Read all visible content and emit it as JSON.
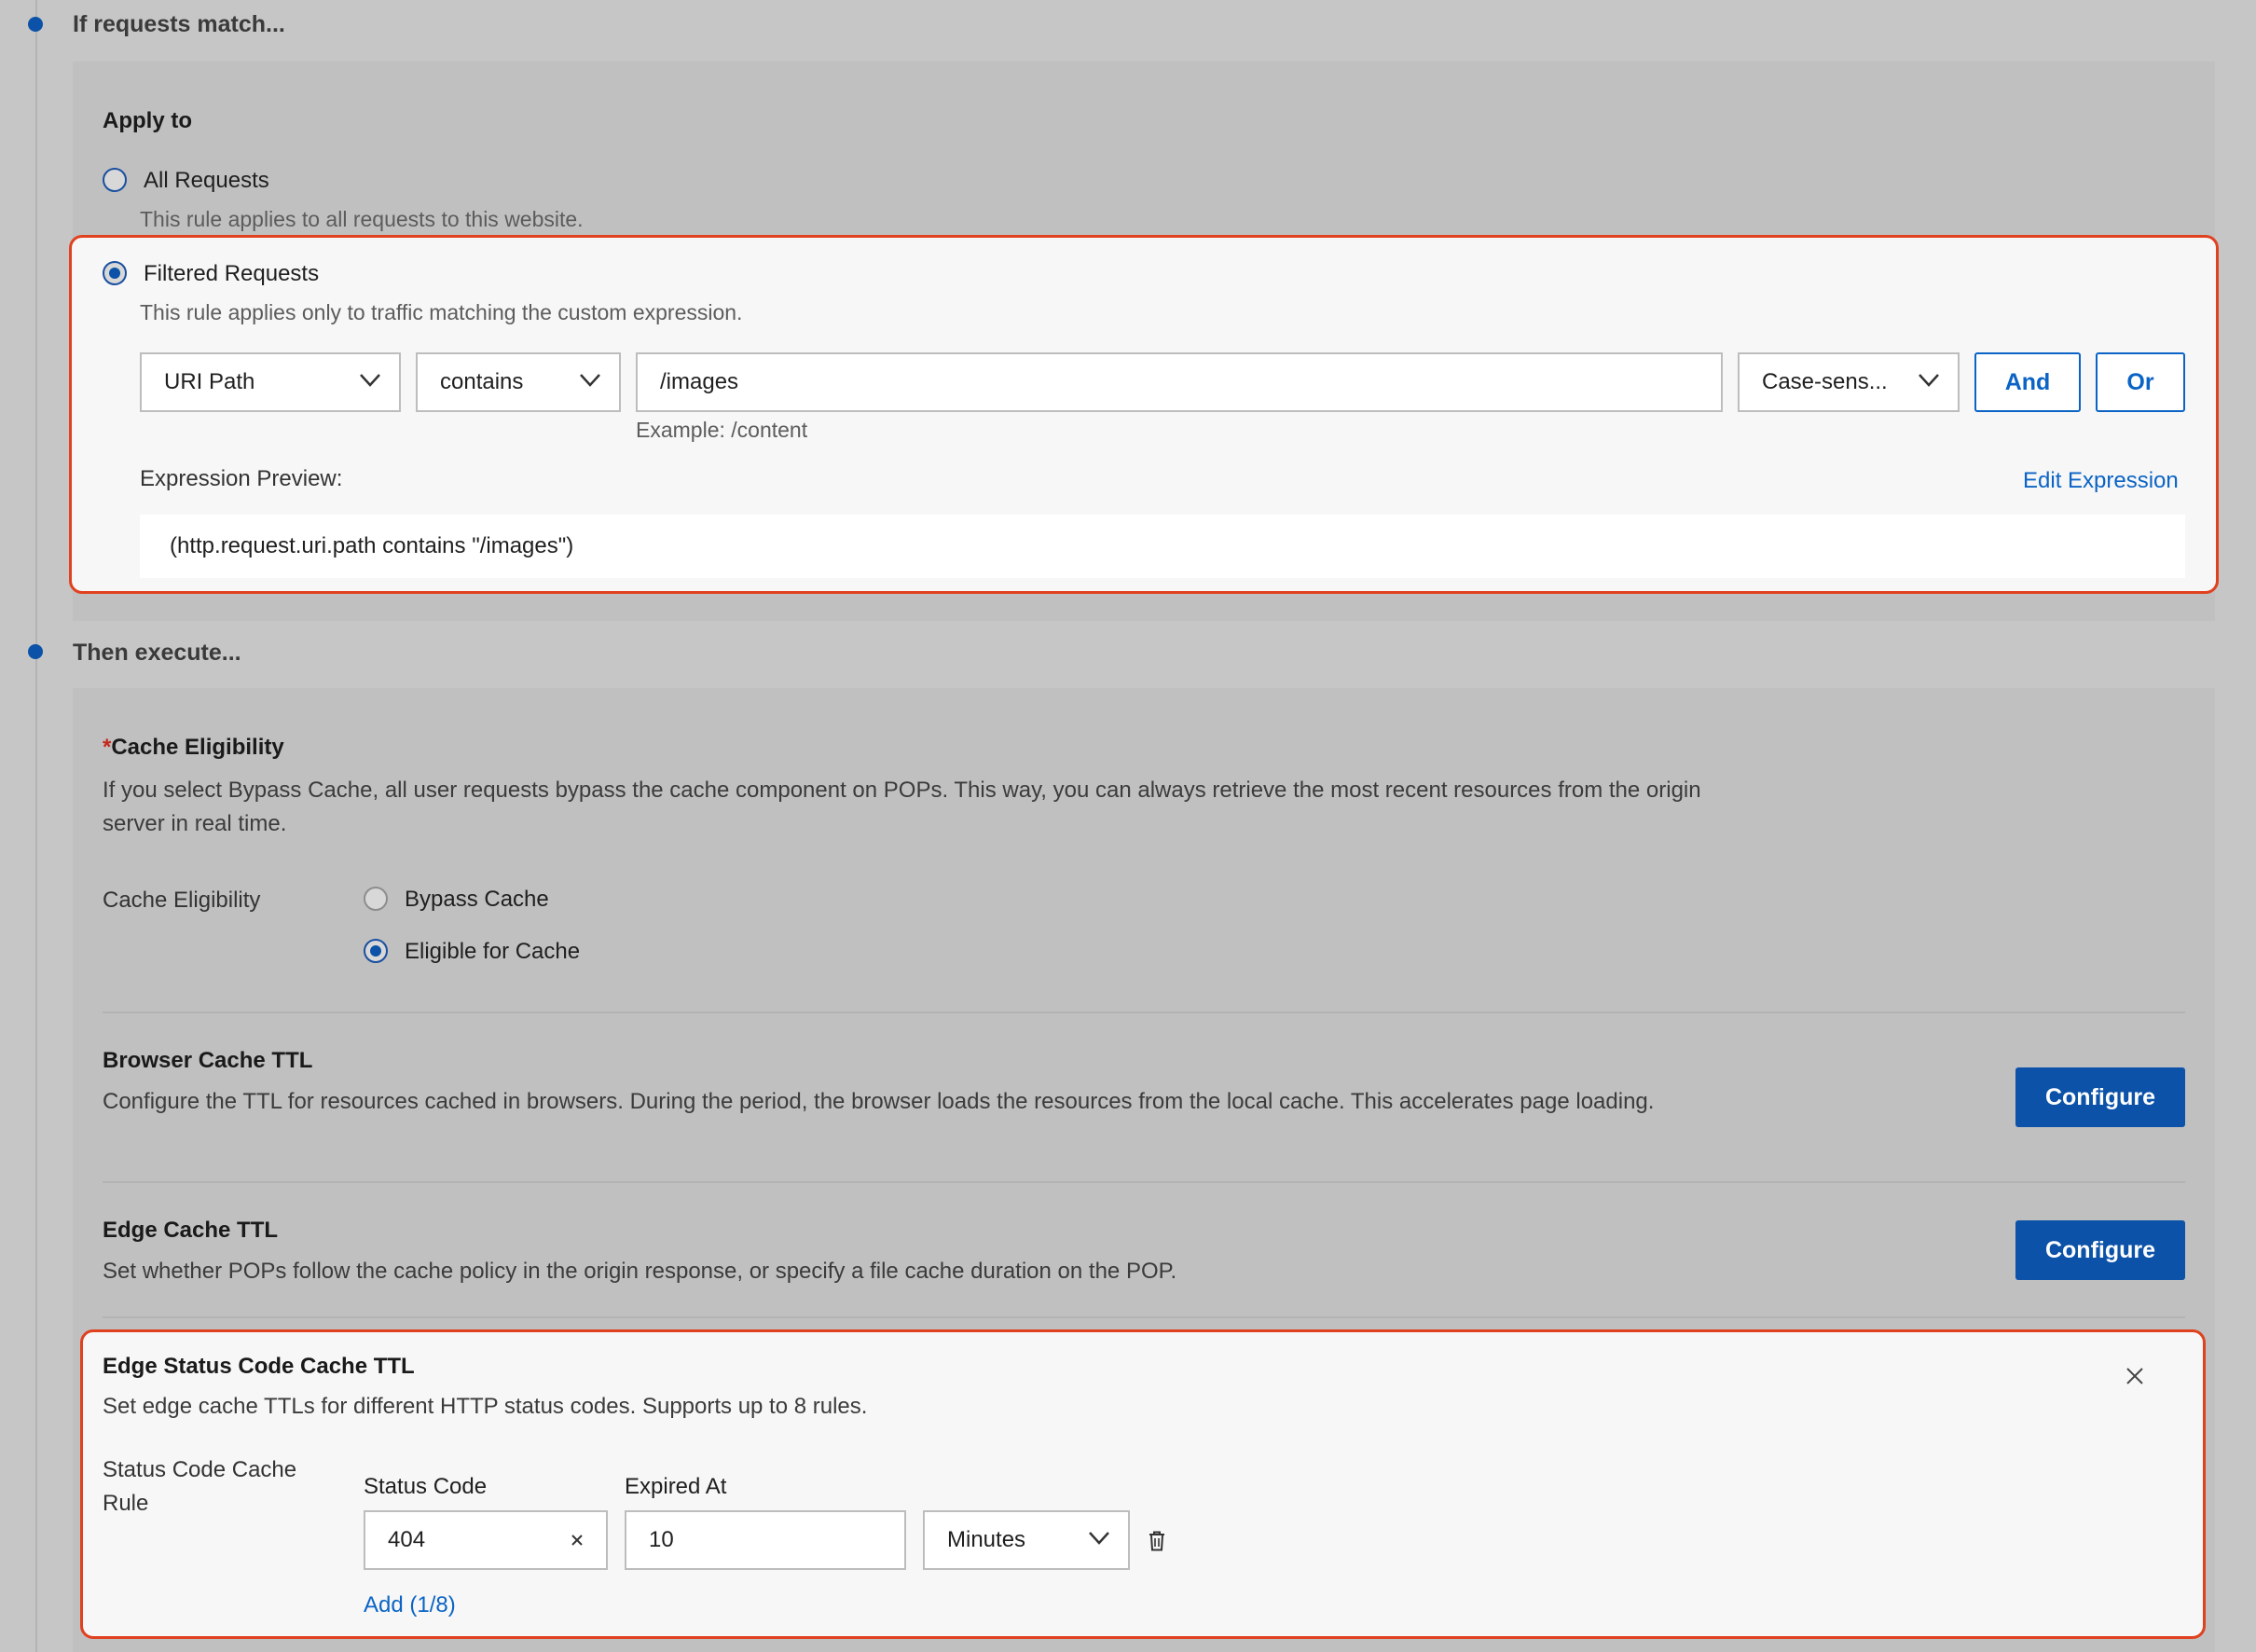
{
  "match_section": {
    "title": "If requests match...",
    "apply_to_label": "Apply to",
    "all_requests": {
      "label": "All Requests",
      "desc": "This rule applies to all requests to this website.",
      "selected": false
    },
    "filtered_requests": {
      "label": "Filtered Requests",
      "desc": "This rule applies only to traffic matching the custom expression.",
      "selected": true
    },
    "condition": {
      "field": "URI Path",
      "operator": "contains",
      "value": "/images",
      "value_hint": "Example: /content",
      "case": "Case-sens...",
      "and_label": "And",
      "or_label": "Or"
    },
    "expression_preview_label": "Expression Preview:",
    "edit_expression_label": "Edit Expression",
    "expression": "(http.request.uri.path contains \"/images\")"
  },
  "execute_section": {
    "title": "Then execute...",
    "cache_eligibility": {
      "required_mark": "*",
      "title": "Cache Eligibility",
      "desc": "If you select Bypass Cache, all user requests bypass the cache component on POPs. This way, you can always retrieve the most recent resources from the origin server in real time.",
      "field_label": "Cache Eligibility",
      "options": [
        {
          "label": "Bypass Cache",
          "selected": false
        },
        {
          "label": "Eligible for Cache",
          "selected": true
        }
      ]
    },
    "browser_cache_ttl": {
      "title": "Browser Cache TTL",
      "desc": "Configure the TTL for resources cached in browsers. During the period, the browser loads the resources from the local cache. This accelerates page loading.",
      "button": "Configure"
    },
    "edge_cache_ttl": {
      "title": "Edge Cache TTL",
      "desc": "Set whether POPs follow the cache policy in the origin response, or specify a file cache duration on the POP.",
      "button": "Configure"
    },
    "status_code_ttl": {
      "title": "Edge Status Code Cache TTL",
      "desc": "Set edge cache TTLs for different HTTP status codes. Supports up to 8 rules.",
      "rule_label": "Status Code Cache Rule",
      "status_code_header": "Status Code",
      "expired_at_header": "Expired At",
      "status_code_value": "404",
      "expired_value": "10",
      "unit": "Minutes",
      "add_label": "Add (1/8)"
    }
  },
  "colors": {
    "accent": "#0b52a8",
    "link": "#0b64c5",
    "highlight_border": "#e0411f",
    "page_bg": "#c6c6c6"
  }
}
